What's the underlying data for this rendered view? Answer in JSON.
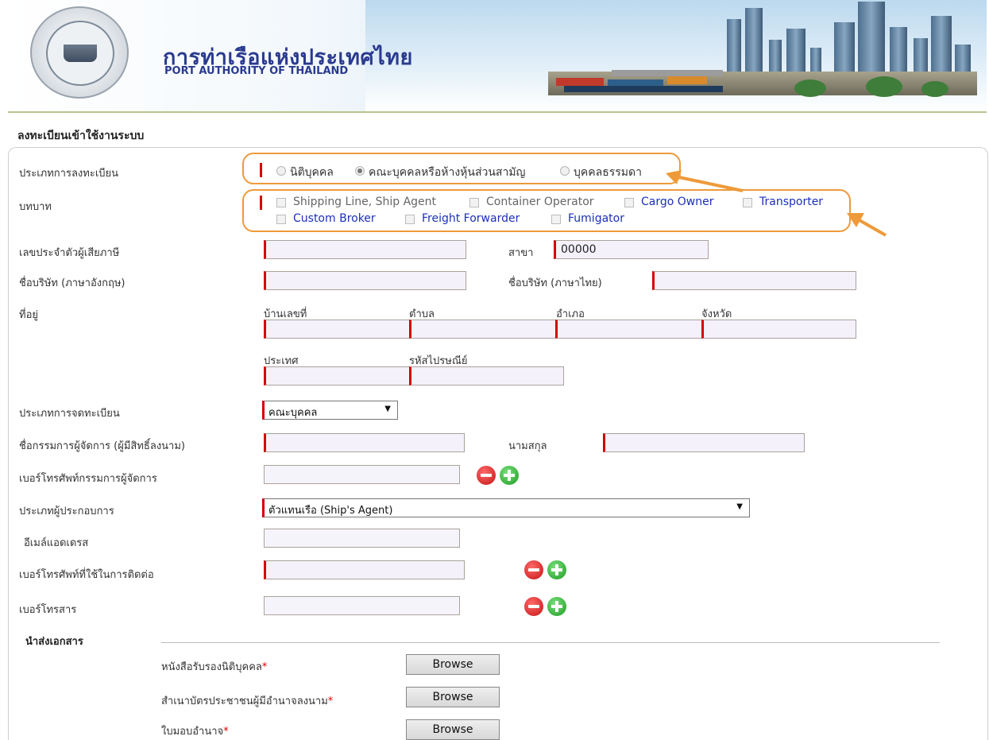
{
  "header": {
    "title_th": "การท่าเรือแห่งประเทศไทย",
    "title_en": "PORT AUTHORITY OF THAILAND"
  },
  "page_title": "ลงทะเบียนเข้าใช้งานระบบ",
  "registration_type": {
    "label": "ประเภทการลงทะเบียน",
    "options": [
      "นิติบุคคล",
      "คณะบุคคลหรือห้างหุ้นส่วนสามัญ",
      "บุคคลธรรมดา"
    ],
    "selected": "คณะบุคคลหรือห้างหุ้นส่วนสามัญ"
  },
  "role": {
    "label": "บทบาท",
    "options": [
      "Shipping Line, Ship Agent",
      "Container Operator",
      "Cargo Owner",
      "Transporter",
      "Custom Broker",
      "Freight Forwarder",
      "Fumigator"
    ]
  },
  "tax_id": {
    "label": "เลขประจำตัวผู้เสียภาษี",
    "value": ""
  },
  "branch": {
    "label": "สาขา",
    "value": "00000"
  },
  "company_en": {
    "label": "ชื่อบริษัท (ภาษาอังกฤษ)",
    "value": ""
  },
  "company_th": {
    "label": "ชื่อบริษัท (ภาษาไทย)",
    "value": ""
  },
  "address": {
    "label": "ที่อยู่",
    "house_no": "บ้านเลขที่",
    "subdistrict": "ตำบล",
    "district": "อำเภอ",
    "province": "จังหวัด",
    "country": "ประเทศ",
    "postal_code": "รหัสไปรษณีย์"
  },
  "registration_kind": {
    "label": "ประเภทการจดทะเบียน",
    "value": "คณะบุคคล"
  },
  "director_name": {
    "label": "ชื่อกรรมการผู้จัดการ (ผู้มีสิทธิ์ลงนาม)"
  },
  "surname": {
    "label": "นามสกุล"
  },
  "director_phone": {
    "label": "เบอร์โทรศัพท์กรรมการผู้จัดการ"
  },
  "operator_type": {
    "label": "ประเภทผู้ประกอบการ",
    "value": "ตัวแทนเรือ (Ship's Agent)"
  },
  "email": {
    "label": "อีเมล์แอดเดรส"
  },
  "contact_phone": {
    "label": "เบอร์โทรศัพท์ที่ใช้ในการติดต่อ"
  },
  "fax": {
    "label": "เบอร์โทรสาร"
  },
  "documents": {
    "heading": "นำส่งเอกสาร",
    "required_mark": "*",
    "browse_label": "Browse",
    "items": [
      "หนังสือรับรองนิติบุคคล",
      "สำเนาบัตรประชาชนผู้มีอำนาจลงนาม",
      "ใบมอบอำนาจ"
    ]
  },
  "colors": {
    "header_text": "#2a3a8e",
    "required_bar": "#d40000",
    "callout": "#ee9a3a",
    "link_blue": "#1c2fb8"
  }
}
